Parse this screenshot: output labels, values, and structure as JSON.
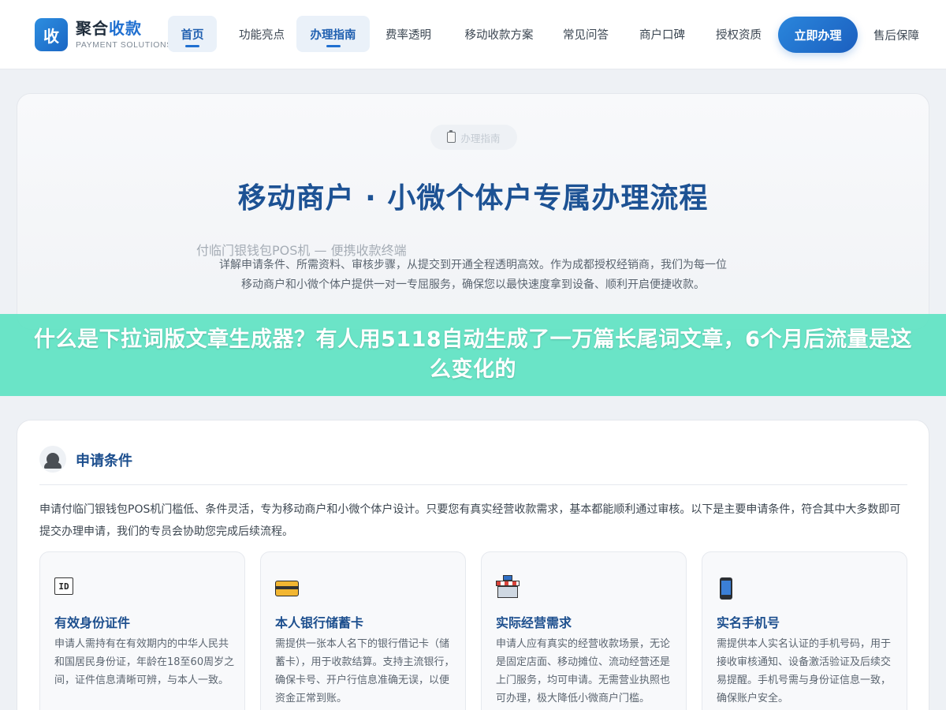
{
  "brand": {
    "logo_char": "收",
    "name_part1": "聚合",
    "name_part2": "收款",
    "subtitle": "PAYMENT SOLUTIONS"
  },
  "nav": {
    "items": [
      {
        "label": "首页"
      },
      {
        "label": "功能亮点"
      },
      {
        "label": "办理指南"
      },
      {
        "label": "费率透明"
      },
      {
        "label": "移动收款方案"
      },
      {
        "label": "常见问答"
      },
      {
        "label": "商户口碑"
      },
      {
        "label": "授权资质"
      }
    ],
    "cta": "立即办理",
    "after_sales": "售后保障"
  },
  "hero": {
    "badge": "办理指南",
    "title": "移动商户 · 小微个体户专属办理流程",
    "ghost_caption": "付临门银钱包POS机 — 便携收款终端",
    "description": "详解申请条件、所需资料、审核步骤，从提交到开通全程透明高效。作为成都授权经销商，我们为每一位移动商户和小微个体户提供一对一专屈服务，确保您以最快速度拿到设备、顺利开启便捷收款。"
  },
  "banner": {
    "text": "什么是下拉词版文章生成器？有人用5118自动生成了一万篇长尾词文章，6个月后流量是这么变化的"
  },
  "conditions": {
    "title": "申请条件",
    "intro": "申请付临门银钱包POS机门槛低、条件灵活，专为移动商户和小微个体户设计。只要您有真实经营收款需求，基本都能顺利通过审核。以下是主要申请条件，符合其中大多数即可提交办理申请，我们的专员会协助您完成后续流程。",
    "cards": [
      {
        "icon": "id-card-icon",
        "icon_text": "ID",
        "title": "有效身份证件",
        "text": "申请人需持有在有效期内的中华人民共和国居民身份证，年龄在18至60周岁之间，证件信息清晰可辨，与本人一致。"
      },
      {
        "icon": "bank-card-icon",
        "title": "本人银行储蓄卡",
        "text": "需提供一张本人名下的银行借记卡（储蓄卡），用于收款结算。支持主流银行，确保卡号、开户行信息准确无误，以便资金正常到账。"
      },
      {
        "icon": "shop-icon",
        "title": "实际经营需求",
        "text": "申请人应有真实的经营收款场景，无论是固定店面、移动摊位、流动经营还是上门服务，均可申请。无需营业执照也可办理，极大降低小微商户门槛。"
      },
      {
        "icon": "mobile-phone-icon",
        "title": "实名手机号",
        "text": "需提供本人实名认证的手机号码，用于接收审核通知、设备激活验证及后续交易提醒。手机号需与身份证信息一致，确保账户安全。"
      }
    ]
  }
}
